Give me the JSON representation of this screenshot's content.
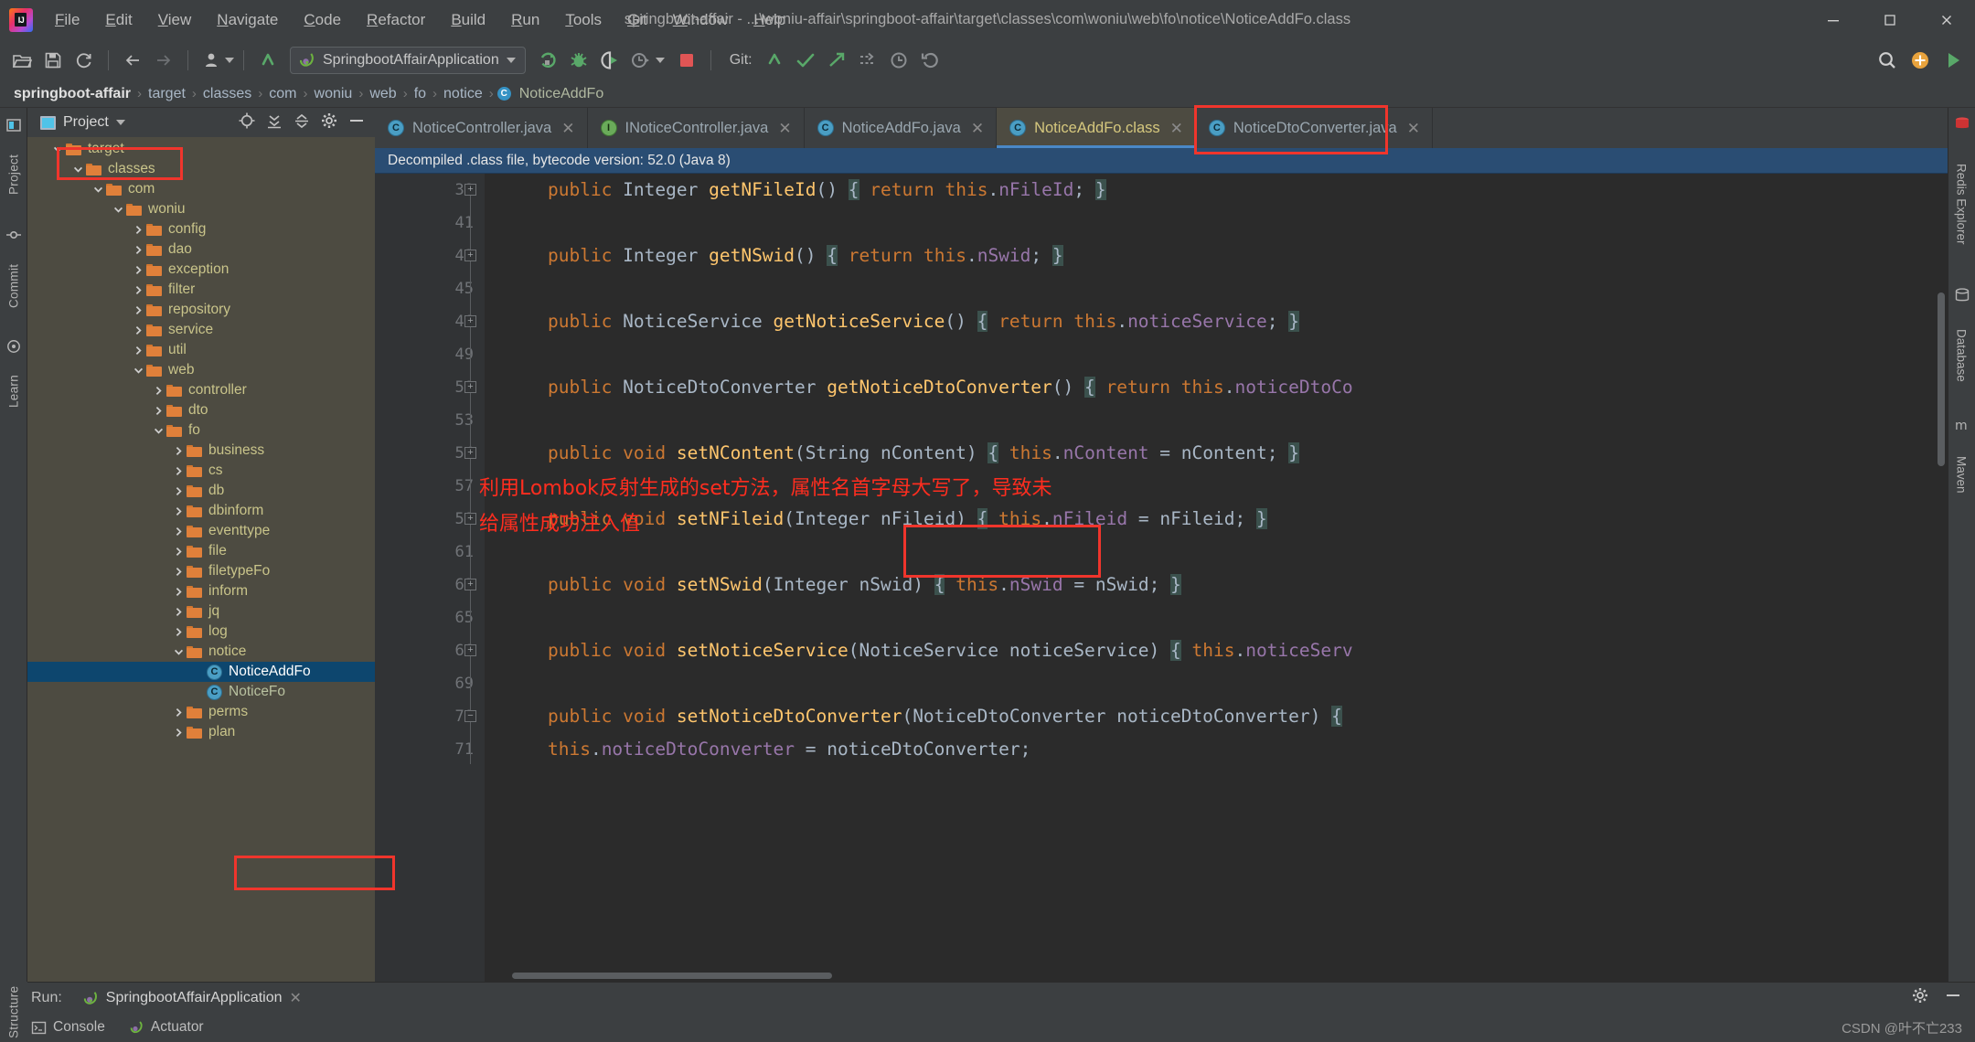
{
  "window": {
    "title": "springboot-affair - ...\\woniu-affair\\springboot-affair\\target\\classes\\com\\woniu\\web\\fo\\notice\\NoticeAddFo.class",
    "app_icon": "intellij-idea-logo",
    "minimize_label": "Minimize",
    "maximize_label": "Maximize",
    "close_label": "Close"
  },
  "menubar": {
    "items": [
      {
        "label": "File",
        "mnemonic": "F"
      },
      {
        "label": "Edit",
        "mnemonic": "E"
      },
      {
        "label": "View",
        "mnemonic": "V"
      },
      {
        "label": "Navigate",
        "mnemonic": "N"
      },
      {
        "label": "Code",
        "mnemonic": "C"
      },
      {
        "label": "Refactor",
        "mnemonic": "R"
      },
      {
        "label": "Build",
        "mnemonic": "B"
      },
      {
        "label": "Run",
        "mnemonic": "R"
      },
      {
        "label": "Tools",
        "mnemonic": "T"
      },
      {
        "label": "Git",
        "mnemonic": "G"
      },
      {
        "label": "Window",
        "mnemonic": "W"
      },
      {
        "label": "Help",
        "mnemonic": "H"
      }
    ]
  },
  "toolbar": {
    "open_label": "Open",
    "save_label": "Save All",
    "sync_label": "Synchronize",
    "back_label": "Back",
    "forward_label": "Forward",
    "profile_label": "Profile",
    "update_label": "Update Project",
    "run_configuration": "SpringbootAffairApplication",
    "run_label": "Run",
    "debug_label": "Debug",
    "run_with_coverage_label": "Run with Coverage",
    "profiler_label": "Profiler",
    "stop_label": "Stop",
    "git_label": "Git:",
    "git_update_label": "Update Project",
    "git_commit_label": "Commit",
    "git_push_label": "Push",
    "git_branch_label": "Branches",
    "git_history_label": "History",
    "git_rollback_label": "Rollback",
    "search_label": "Search Everywhere",
    "plugin_label": "Plugins",
    "run_right_label": "Run"
  },
  "breadcrumb": {
    "items": [
      "springboot-affair",
      "target",
      "classes",
      "com",
      "woniu",
      "web",
      "fo",
      "notice"
    ],
    "leaf": "NoticeAddFo",
    "leaf_icon": "class-icon",
    "separator": "›"
  },
  "left_rail": {
    "items": [
      {
        "label": "Project",
        "icon": "project-icon"
      },
      {
        "label": "Commit",
        "icon": "commit-icon"
      },
      {
        "label": "Learn",
        "icon": "learn-icon"
      }
    ],
    "bottom_label": "Structure"
  },
  "right_rail": {
    "items": [
      {
        "label": "Redis Explorer",
        "icon": "redis-icon"
      },
      {
        "label": "Database",
        "icon": "database-icon"
      },
      {
        "label": "Maven",
        "icon": "maven-icon"
      }
    ]
  },
  "project_panel": {
    "title": "Project",
    "dropdown_icon": "chevron-down-icon",
    "actions": [
      "locate-icon",
      "expand-all-icon",
      "collapse-all-icon",
      "gear-icon",
      "hide-icon"
    ],
    "tree": [
      {
        "label": "target",
        "depth": 0,
        "type": "folder",
        "state": "expanded",
        "selected": false,
        "annotated": true
      },
      {
        "label": "classes",
        "depth": 1,
        "type": "folder",
        "state": "expanded",
        "selected": false
      },
      {
        "label": "com",
        "depth": 2,
        "type": "folder",
        "state": "expanded",
        "selected": false
      },
      {
        "label": "woniu",
        "depth": 3,
        "type": "folder",
        "state": "expanded",
        "selected": false
      },
      {
        "label": "config",
        "depth": 4,
        "type": "folder",
        "state": "collapsed",
        "selected": false
      },
      {
        "label": "dao",
        "depth": 4,
        "type": "folder",
        "state": "collapsed",
        "selected": false
      },
      {
        "label": "exception",
        "depth": 4,
        "type": "folder",
        "state": "collapsed",
        "selected": false
      },
      {
        "label": "filter",
        "depth": 4,
        "type": "folder",
        "state": "collapsed",
        "selected": false
      },
      {
        "label": "repository",
        "depth": 4,
        "type": "folder",
        "state": "collapsed",
        "selected": false
      },
      {
        "label": "service",
        "depth": 4,
        "type": "folder",
        "state": "collapsed",
        "selected": false
      },
      {
        "label": "util",
        "depth": 4,
        "type": "folder",
        "state": "collapsed",
        "selected": false
      },
      {
        "label": "web",
        "depth": 4,
        "type": "folder",
        "state": "expanded",
        "selected": false
      },
      {
        "label": "controller",
        "depth": 5,
        "type": "folder",
        "state": "collapsed",
        "selected": false
      },
      {
        "label": "dto",
        "depth": 5,
        "type": "folder",
        "state": "collapsed",
        "selected": false
      },
      {
        "label": "fo",
        "depth": 5,
        "type": "folder",
        "state": "expanded",
        "selected": false
      },
      {
        "label": "business",
        "depth": 6,
        "type": "folder",
        "state": "collapsed",
        "selected": false
      },
      {
        "label": "cs",
        "depth": 6,
        "type": "folder",
        "state": "collapsed",
        "selected": false
      },
      {
        "label": "db",
        "depth": 6,
        "type": "folder",
        "state": "collapsed",
        "selected": false
      },
      {
        "label": "dbinform",
        "depth": 6,
        "type": "folder",
        "state": "collapsed",
        "selected": false
      },
      {
        "label": "eventtype",
        "depth": 6,
        "type": "folder",
        "state": "collapsed",
        "selected": false
      },
      {
        "label": "file",
        "depth": 6,
        "type": "folder",
        "state": "collapsed",
        "selected": false
      },
      {
        "label": "filetypeFo",
        "depth": 6,
        "type": "folder",
        "state": "collapsed",
        "selected": false
      },
      {
        "label": "inform",
        "depth": 6,
        "type": "folder",
        "state": "collapsed",
        "selected": false
      },
      {
        "label": "jq",
        "depth": 6,
        "type": "folder",
        "state": "collapsed",
        "selected": false
      },
      {
        "label": "log",
        "depth": 6,
        "type": "folder",
        "state": "collapsed",
        "selected": false
      },
      {
        "label": "notice",
        "depth": 6,
        "type": "folder",
        "state": "expanded",
        "selected": false
      },
      {
        "label": "NoticeAddFo",
        "depth": 7,
        "type": "class",
        "state": "none",
        "selected": true,
        "annotated": true
      },
      {
        "label": "NoticeFo",
        "depth": 7,
        "type": "class",
        "state": "none",
        "selected": false
      },
      {
        "label": "perms",
        "depth": 6,
        "type": "folder",
        "state": "collapsed",
        "selected": false
      },
      {
        "label": "plan",
        "depth": 6,
        "type": "folder",
        "state": "collapsed",
        "selected": false
      }
    ]
  },
  "editor": {
    "tabs": [
      {
        "label": "NoticeController.java",
        "icon": "class-icon",
        "icon_letter": "C",
        "active": false
      },
      {
        "label": "INoticeController.java",
        "icon": "interface-icon",
        "icon_letter": "I",
        "active": false
      },
      {
        "label": "NoticeAddFo.java",
        "icon": "class-icon",
        "icon_letter": "C",
        "active": false
      },
      {
        "label": "NoticeAddFo.class",
        "icon": "class-icon",
        "icon_letter": "C",
        "active": true,
        "annotated": true
      },
      {
        "label": "NoticeDtoConverter.java",
        "icon": "class-icon",
        "icon_letter": "C",
        "active": false
      }
    ],
    "close_icon": "close-icon",
    "notice_bar": "Decompiled .class file, bytecode version: 52.0 (Java 8)",
    "lines": [
      {
        "num": "38",
        "fold": "plus",
        "text": "public Integer getNFileId() { return this.nFileId; }"
      },
      {
        "num": "41",
        "fold": "",
        "text": ""
      },
      {
        "num": "42",
        "fold": "plus",
        "text": "public Integer getNSwid() { return this.nSwid; }"
      },
      {
        "num": "45",
        "fold": "",
        "text": ""
      },
      {
        "num": "46",
        "fold": "plus",
        "text": "public NoticeService getNoticeService() { return this.noticeService; }"
      },
      {
        "num": "49",
        "fold": "",
        "text": ""
      },
      {
        "num": "50",
        "fold": "plus",
        "text": "public NoticeDtoConverter getNoticeDtoConverter() { return this.noticeDtoCo"
      },
      {
        "num": "53",
        "fold": "",
        "text": ""
      },
      {
        "num": "54",
        "fold": "plus",
        "text": "public void setNContent(String nContent) { this.nContent = nContent; }"
      },
      {
        "num": "57",
        "fold": "",
        "text": ""
      },
      {
        "num": "58",
        "fold": "plus",
        "text": "public void setNFileid(Integer nFileid) { this.nFileid = nFileid; }"
      },
      {
        "num": "61",
        "fold": "",
        "text": ""
      },
      {
        "num": "62",
        "fold": "plus",
        "text": "public void setNSwid(Integer nSwid) { this.nSwid = nSwid; }"
      },
      {
        "num": "65",
        "fold": "",
        "text": ""
      },
      {
        "num": "66",
        "fold": "plus",
        "text": "public void setNoticeService(NoticeService noticeService) { this.noticeServ"
      },
      {
        "num": "69",
        "fold": "",
        "text": ""
      },
      {
        "num": "70",
        "fold": "minus",
        "text": "public void setNoticeDtoConverter(NoticeDtoConverter noticeDtoConverter) {"
      },
      {
        "num": "71",
        "fold": "",
        "text": "    this.noticeDtoConverter = noticeDtoConverter;"
      }
    ]
  },
  "annotations": {
    "color": "#ff2d1f",
    "note_line_1": "利用Lombok反射生成的set方法，属性名首字母大写了，导致未",
    "note_line_2": "给属性成功注入值",
    "boxes": [
      "tree-target-box",
      "tree-noticeaddfo-box",
      "tab-noticeaddfo-class-box",
      "code-setncontent-box"
    ]
  },
  "bottom": {
    "run_label": "Run:",
    "run_tab": "SpringbootAffairApplication",
    "run_tab_close": "close-icon",
    "run_tab_icon": "spring-icon",
    "settings_icon": "gear-icon",
    "minimize_icon": "minimize-icon",
    "console_label": "Console",
    "actuator_label": "Actuator",
    "structure_label": "Structure",
    "watermark": "CSDN @叶不亡233"
  }
}
